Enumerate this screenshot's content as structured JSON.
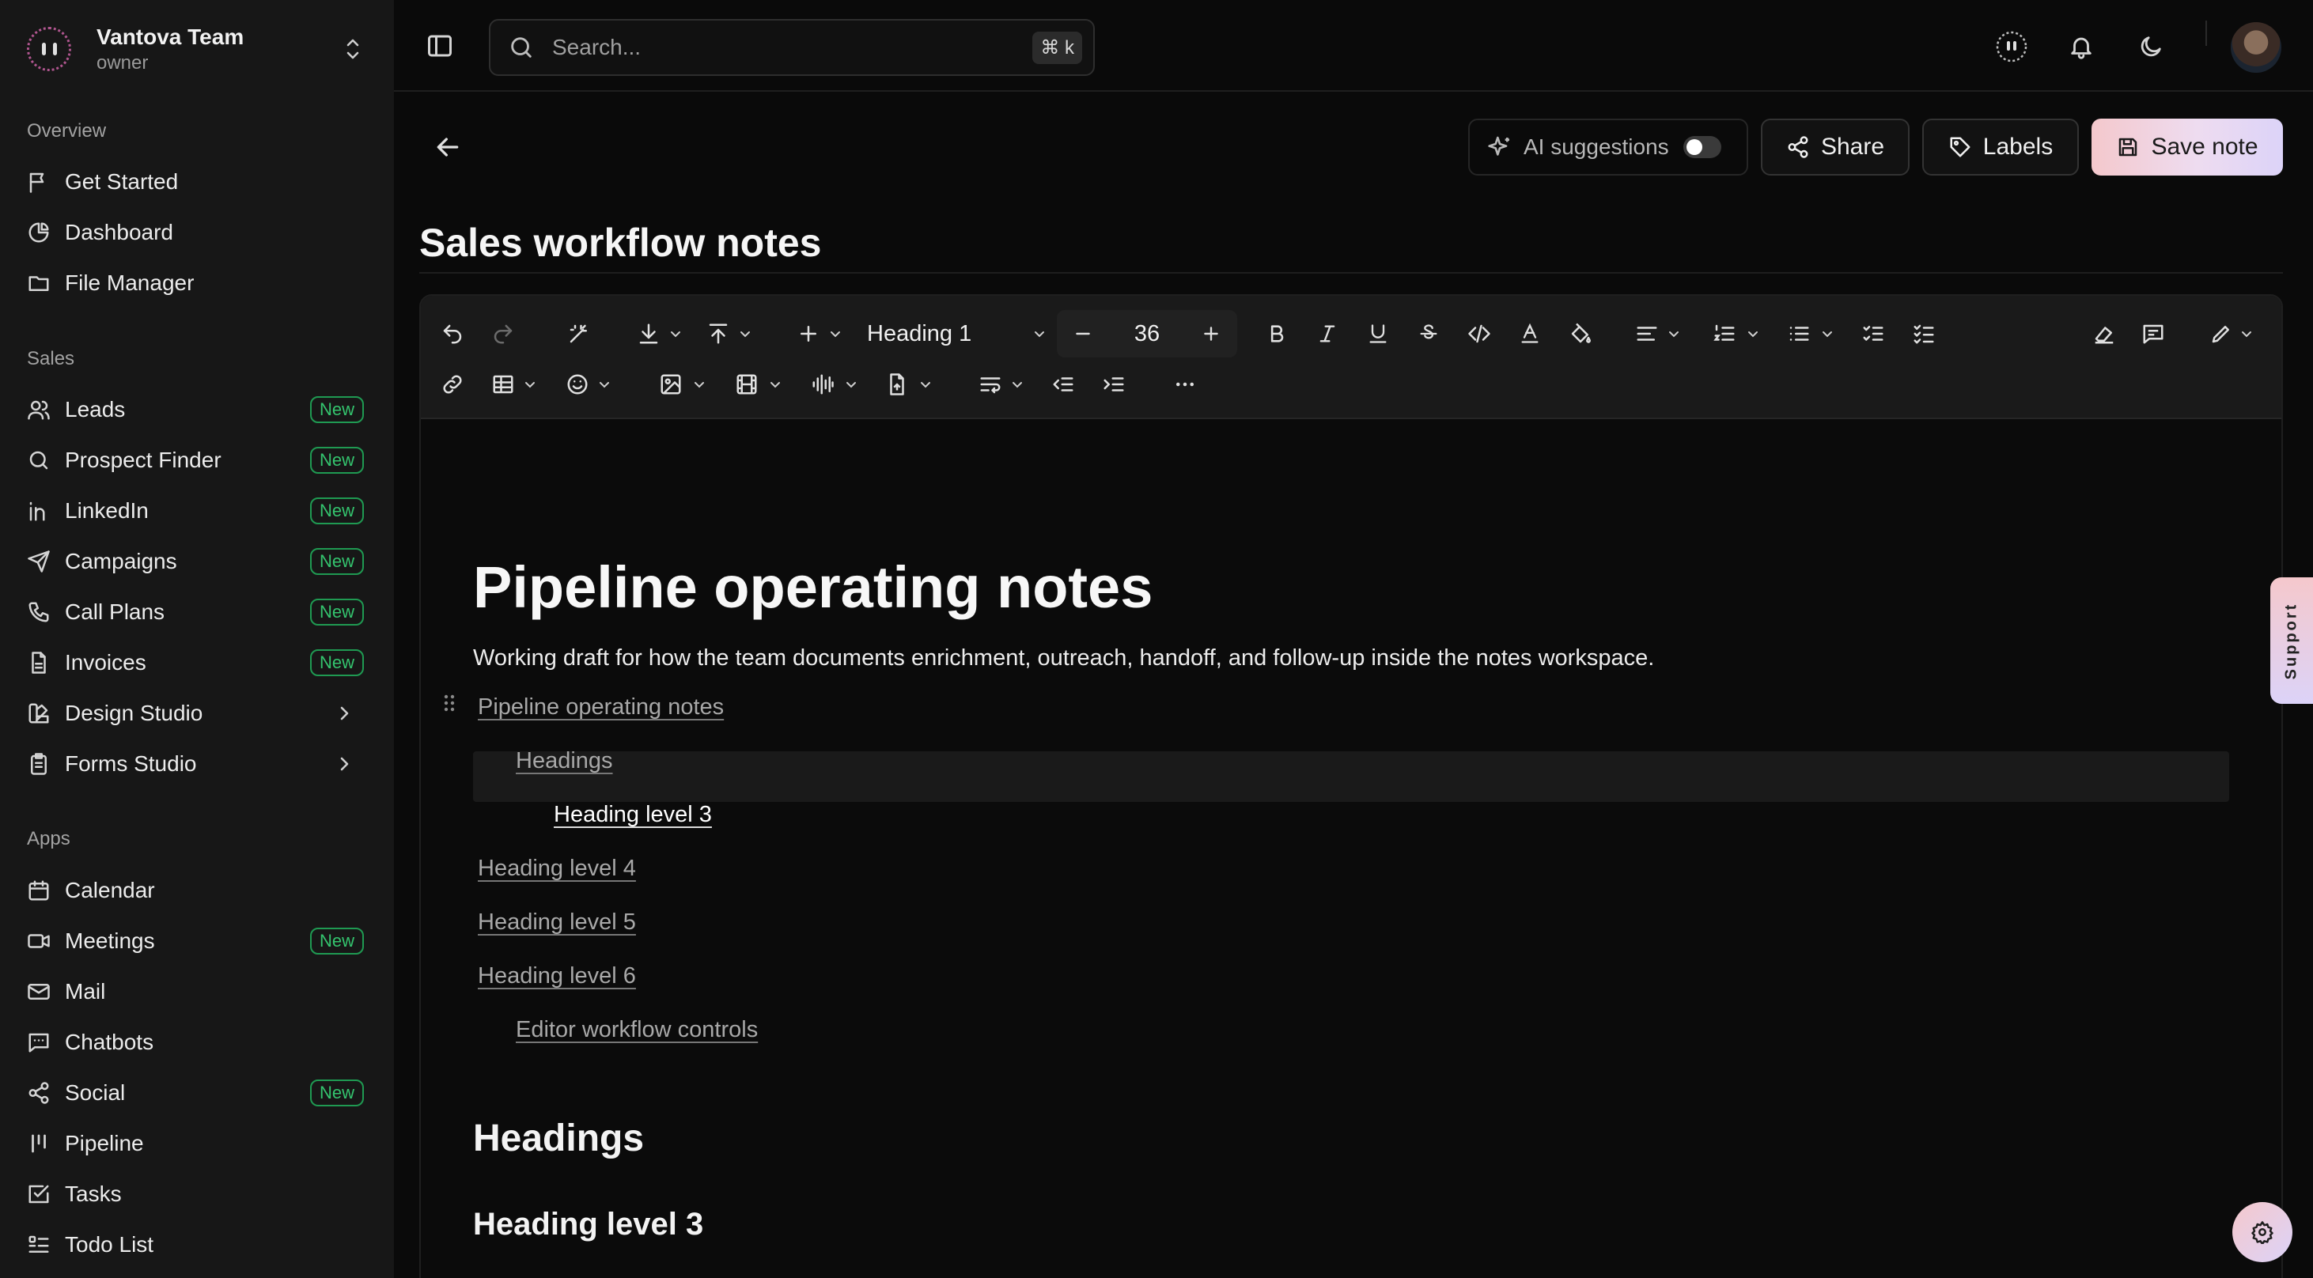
{
  "team": {
    "name": "Vantova Team",
    "role": "owner"
  },
  "sidebar": {
    "sections": [
      {
        "label": "Overview",
        "items": [
          {
            "label": "Get Started",
            "icon": "flag-icon"
          },
          {
            "label": "Dashboard",
            "icon": "pie-chart-icon"
          },
          {
            "label": "File Manager",
            "icon": "folder-icon"
          }
        ]
      },
      {
        "label": "Sales",
        "items": [
          {
            "label": "Leads",
            "icon": "users-icon",
            "badge": "New"
          },
          {
            "label": "Prospect Finder",
            "icon": "search-icon",
            "badge": "New"
          },
          {
            "label": "LinkedIn",
            "icon": "linkedin-icon",
            "badge": "New"
          },
          {
            "label": "Campaigns",
            "icon": "send-icon",
            "badge": "New"
          },
          {
            "label": "Call Plans",
            "icon": "phone-icon",
            "badge": "New"
          },
          {
            "label": "Invoices",
            "icon": "file-text-icon",
            "badge": "New"
          },
          {
            "label": "Design Studio",
            "icon": "palette-icon"
          },
          {
            "label": "Forms Studio",
            "icon": "clipboard-icon"
          }
        ]
      },
      {
        "label": "Apps",
        "items": [
          {
            "label": "Calendar",
            "icon": "calendar-icon"
          },
          {
            "label": "Meetings",
            "icon": "video-icon",
            "badge": "New"
          },
          {
            "label": "Mail",
            "icon": "mail-icon"
          },
          {
            "label": "Chatbots",
            "icon": "message-icon"
          },
          {
            "label": "Social",
            "icon": "share-icon",
            "badge": "New"
          },
          {
            "label": "Pipeline",
            "icon": "kanban-icon"
          },
          {
            "label": "Tasks",
            "icon": "check-square-icon"
          },
          {
            "label": "Todo List",
            "icon": "list-todo-icon"
          }
        ]
      }
    ]
  },
  "topbar": {
    "search_placeholder": "Search...",
    "shortcut": "⌘ k"
  },
  "header": {
    "ai_suggestions_label": "AI suggestions",
    "ai_suggestions_on": false,
    "share_label": "Share",
    "labels_label": "Labels",
    "save_label": "Save note"
  },
  "document": {
    "title": "Sales workflow notes"
  },
  "toolbar": {
    "block_type": "Heading 1",
    "font_size": "36"
  },
  "editor": {
    "h1": "Pipeline operating notes",
    "intro": "Working draft for how the team documents enrichment, outreach, handoff, and follow-up inside the notes workspace.",
    "toc": [
      {
        "label": "Pipeline operating notes",
        "level": 1
      },
      {
        "label": "Headings",
        "level": 2
      },
      {
        "label": "Heading level 3",
        "level": 3,
        "active": true
      },
      {
        "label": "Heading level 4",
        "level": 1
      },
      {
        "label": "Heading level 5",
        "level": 1
      },
      {
        "label": "Heading level 6",
        "level": 1
      },
      {
        "label": "Editor workflow controls",
        "level": 2
      }
    ],
    "h2": "Headings",
    "h3": "Heading level 3"
  },
  "support_label": "Support",
  "colors": {
    "badge_green": "#34c46e",
    "accent_pink": "#f4c8cc",
    "accent_lavender": "#dcd3f8"
  }
}
